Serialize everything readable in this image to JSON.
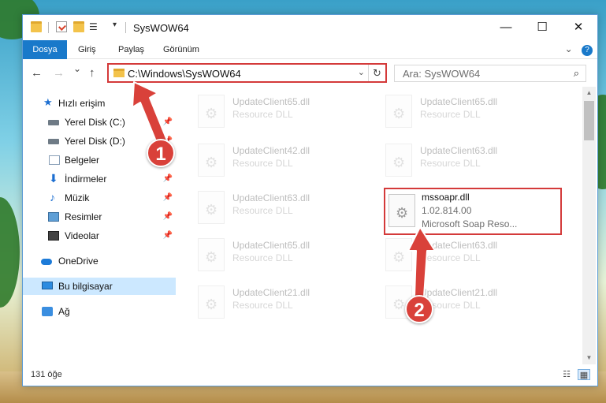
{
  "window": {
    "title": "SysWOW64",
    "controls": {
      "minimize": "—",
      "maximize": "☐",
      "close": "✕"
    }
  },
  "ribbon": {
    "tabs": [
      "Dosya",
      "Giriş",
      "Paylaş",
      "Görünüm"
    ],
    "expand_icon": "chevron-down-icon",
    "help_icon": "help-icon"
  },
  "navigation": {
    "back": "←",
    "forward": "→",
    "recent": "⌄",
    "up": "↑",
    "address": "C:\\Windows\\SysWOW64",
    "search_placeholder": "Ara: SysWOW64"
  },
  "sidebar": {
    "items": [
      {
        "label": "Hızlı erişim",
        "icon": "star-icon",
        "pinned": false
      },
      {
        "label": "Yerel Disk (C:)",
        "icon": "drive-icon",
        "pinned": true
      },
      {
        "label": "Yerel Disk (D:)",
        "icon": "drive-icon",
        "pinned": true
      },
      {
        "label": "Belgeler",
        "icon": "documents-icon",
        "pinned": true
      },
      {
        "label": "İndirmeler",
        "icon": "download-icon",
        "pinned": true
      },
      {
        "label": "Müzik",
        "icon": "music-icon",
        "pinned": true
      },
      {
        "label": "Resimler",
        "icon": "pictures-icon",
        "pinned": true
      },
      {
        "label": "Videolar",
        "icon": "videos-icon",
        "pinned": true
      },
      {
        "label": "OneDrive",
        "icon": "cloud-icon",
        "pinned": false
      },
      {
        "label": "Bu bilgisayar",
        "icon": "computer-icon",
        "pinned": false,
        "selected": true
      },
      {
        "label": "Ağ",
        "icon": "network-icon",
        "pinned": false
      }
    ]
  },
  "files": {
    "left_column": [
      {
        "name": "UpdateClient65.dll",
        "desc": "Resource DLL"
      },
      {
        "name": "UpdateClient42.dll",
        "desc": "Resource DLL"
      },
      {
        "name": "UpdateClient63.dll",
        "desc": "Resource DLL"
      },
      {
        "name": "UpdateClient65.dll",
        "desc": "Resource DLL"
      },
      {
        "name": "UpdateClient21.dll",
        "desc": "Resource DLL"
      }
    ],
    "right_column": [
      {
        "name": "UpdateClient65.dll",
        "desc": "Resource DLL"
      },
      {
        "name": "UpdateClient63.dll",
        "desc": "Resource DLL"
      },
      {
        "name": "UpdateClient63.dll",
        "desc": "Resource DLL"
      },
      {
        "name": "UpdateClient21.dll",
        "desc": "Resource DLL"
      }
    ],
    "highlighted": {
      "name": "mssoapr.dll",
      "version": "1.02.814.00",
      "desc": "Microsoft Soap Reso..."
    }
  },
  "status": {
    "count": "131 öğe"
  },
  "annotations": {
    "step1": "1",
    "step2": "2",
    "color": "#d9413a"
  }
}
